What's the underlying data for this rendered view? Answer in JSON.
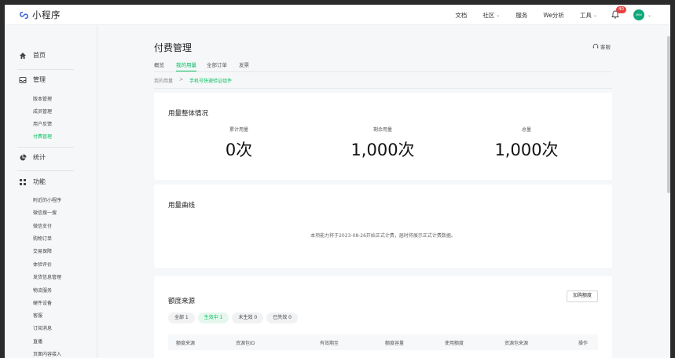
{
  "app": {
    "name": "小程序"
  },
  "topnav": {
    "items": [
      {
        "label": "文档",
        "dropdown": false
      },
      {
        "label": "社区",
        "dropdown": true
      },
      {
        "label": "服务",
        "dropdown": false
      },
      {
        "label": "We分析",
        "dropdown": false
      },
      {
        "label": "工具",
        "dropdown": true
      }
    ],
    "notification_count": "40",
    "avatar_text": "MINI"
  },
  "sidebar": {
    "home": "首页",
    "manage": "管理",
    "manage_items": [
      "版本管理",
      "成员管理",
      "用户反馈",
      "付费管理"
    ],
    "stats": "统计",
    "features": "功能",
    "feature_items": [
      "附近的小程序",
      "微信搜一搜",
      "微信支付",
      "购物订单",
      "交易保障",
      "体验评价",
      "发货信息管理",
      "物流服务",
      "硬件设备",
      "客服",
      "订阅消息",
      "直播",
      "页面内容接入"
    ]
  },
  "page": {
    "title": "付费管理",
    "kefu": "客服",
    "tabs": [
      "概览",
      "我的用量",
      "全部订单",
      "发票"
    ],
    "active_tab": "我的用量",
    "breadcrumb": {
      "parent": "我的用量",
      "separator": ">",
      "current": "手机号快速验证组件"
    }
  },
  "usage_overview": {
    "title": "用量整体情况",
    "stats": [
      {
        "label": "累计用量",
        "value": "0次"
      },
      {
        "label": "剩余用量",
        "value": "1,000次"
      },
      {
        "label": "总量",
        "value": "1,000次"
      }
    ]
  },
  "usage_curve": {
    "title": "用量曲线",
    "notice": "本项能力将于2023-08-26开始正式计费，届时将展示正式计费数据。"
  },
  "quota_source": {
    "title": "额度来源",
    "buy_button": "加购额度",
    "filters": [
      "全部 1",
      "生效中 1",
      "未生效 0",
      "已失效 0"
    ],
    "active_filter": "生效中 1",
    "columns": [
      "额度来源",
      "资源包ID",
      "有效期至",
      "额度容量",
      "使用额度",
      "资源包来源",
      "操作"
    ]
  },
  "colors": {
    "accent": "#07c160",
    "badge": "#e64340"
  }
}
